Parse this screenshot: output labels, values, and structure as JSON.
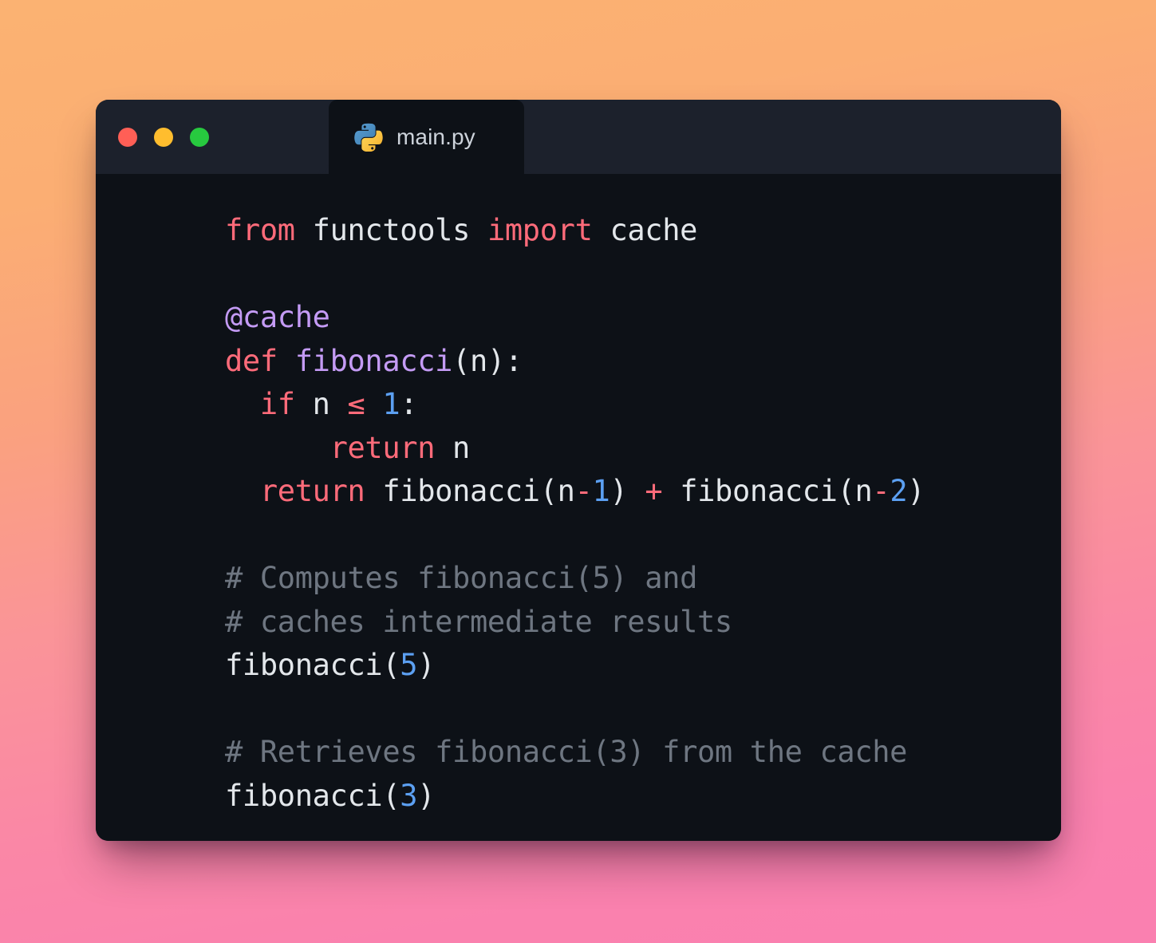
{
  "window": {
    "traffic_lights": [
      {
        "name": "close",
        "color": "#FF5F56"
      },
      {
        "name": "minimize",
        "color": "#FFBD2E"
      },
      {
        "name": "zoom",
        "color": "#27C93F"
      }
    ],
    "tab": {
      "label": "main.py",
      "icon": "python-icon"
    }
  },
  "theme": {
    "window_background": "#0D1117",
    "titlebar_background": "#1C212C",
    "gradient_start": "#FBB272",
    "gradient_end": "#FA81AE",
    "keyword": "#FF6B7A",
    "decorator": "#C49BF5",
    "function": "#C49BF5",
    "number": "#5CA0F2",
    "comment": "#6E7681",
    "plain": "#E3E7EB"
  },
  "code": {
    "language": "python",
    "filename": "main.py",
    "plain_text": "from functools import cache\n\n@cache\ndef fibonacci(n):\n  if n <= 1:\n      return n\n  return fibonacci(n-1) + fibonacci(n-2)\n\n# Computes fibonacci(5) and\n# caches intermediate results\nfibonacci(5)\n\n# Retrieves fibonacci(3) from the cache\nfibonacci(3)",
    "lines": [
      {
        "n": 1,
        "tokens": [
          {
            "t": "from",
            "c": "keyword"
          },
          {
            "t": " ",
            "c": "plain"
          },
          {
            "t": "functools",
            "c": "plain"
          },
          {
            "t": " ",
            "c": "plain"
          },
          {
            "t": "import",
            "c": "keyword"
          },
          {
            "t": " ",
            "c": "plain"
          },
          {
            "t": "cache",
            "c": "plain"
          }
        ]
      },
      {
        "n": 2,
        "tokens": []
      },
      {
        "n": 3,
        "tokens": [
          {
            "t": "@cache",
            "c": "deco"
          }
        ]
      },
      {
        "n": 4,
        "tokens": [
          {
            "t": "def",
            "c": "keyword"
          },
          {
            "t": " ",
            "c": "plain"
          },
          {
            "t": "fibonacci",
            "c": "func"
          },
          {
            "t": "(",
            "c": "punct"
          },
          {
            "t": "n",
            "c": "plain"
          },
          {
            "t": "):",
            "c": "punct"
          }
        ]
      },
      {
        "n": 5,
        "tokens": [
          {
            "t": "  ",
            "c": "plain"
          },
          {
            "t": "if",
            "c": "keyword"
          },
          {
            "t": " n ",
            "c": "plain"
          },
          {
            "t": "≤",
            "c": "operator"
          },
          {
            "t": " ",
            "c": "plain"
          },
          {
            "t": "1",
            "c": "number"
          },
          {
            "t": ":",
            "c": "punct"
          }
        ]
      },
      {
        "n": 6,
        "tokens": [
          {
            "t": "      ",
            "c": "plain"
          },
          {
            "t": "return",
            "c": "keyword"
          },
          {
            "t": " n",
            "c": "plain"
          }
        ]
      },
      {
        "n": 7,
        "tokens": [
          {
            "t": "  ",
            "c": "plain"
          },
          {
            "t": "return",
            "c": "keyword"
          },
          {
            "t": " ",
            "c": "plain"
          },
          {
            "t": "fibonacci",
            "c": "plain"
          },
          {
            "t": "(",
            "c": "punct"
          },
          {
            "t": "n",
            "c": "plain"
          },
          {
            "t": "-",
            "c": "operator"
          },
          {
            "t": "1",
            "c": "number"
          },
          {
            "t": ")",
            "c": "punct"
          },
          {
            "t": " ",
            "c": "plain"
          },
          {
            "t": "+",
            "c": "operator"
          },
          {
            "t": " ",
            "c": "plain"
          },
          {
            "t": "fibonacci",
            "c": "plain"
          },
          {
            "t": "(",
            "c": "punct"
          },
          {
            "t": "n",
            "c": "plain"
          },
          {
            "t": "-",
            "c": "operator"
          },
          {
            "t": "2",
            "c": "number"
          },
          {
            "t": ")",
            "c": "punct"
          }
        ]
      },
      {
        "n": 8,
        "tokens": []
      },
      {
        "n": 9,
        "tokens": [
          {
            "t": "# Computes fibonacci(5) and",
            "c": "comment"
          }
        ]
      },
      {
        "n": 10,
        "tokens": [
          {
            "t": "# caches intermediate results",
            "c": "comment"
          }
        ]
      },
      {
        "n": 11,
        "tokens": [
          {
            "t": "fibonacci",
            "c": "plain"
          },
          {
            "t": "(",
            "c": "punct"
          },
          {
            "t": "5",
            "c": "number"
          },
          {
            "t": ")",
            "c": "punct"
          }
        ]
      },
      {
        "n": 12,
        "tokens": []
      },
      {
        "n": 13,
        "tokens": [
          {
            "t": "# Retrieves fibonacci(3) from the cache",
            "c": "comment"
          }
        ]
      },
      {
        "n": 14,
        "tokens": [
          {
            "t": "fibonacci",
            "c": "plain"
          },
          {
            "t": "(",
            "c": "punct"
          },
          {
            "t": "3",
            "c": "number"
          },
          {
            "t": ")",
            "c": "punct"
          }
        ]
      }
    ]
  }
}
